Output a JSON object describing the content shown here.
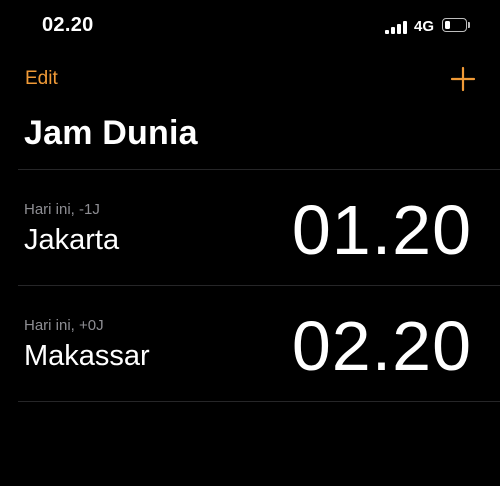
{
  "status_bar": {
    "time": "02.20",
    "network": "4G"
  },
  "nav": {
    "edit_label": "Edit",
    "accent_color": "#f09a37"
  },
  "page": {
    "title": "Jam Dunia"
  },
  "clocks": [
    {
      "offset": "Hari ini, -1J",
      "city": "Jakarta",
      "time": "01.20"
    },
    {
      "offset": "Hari ini, +0J",
      "city": "Makassar",
      "time": "02.20"
    }
  ]
}
